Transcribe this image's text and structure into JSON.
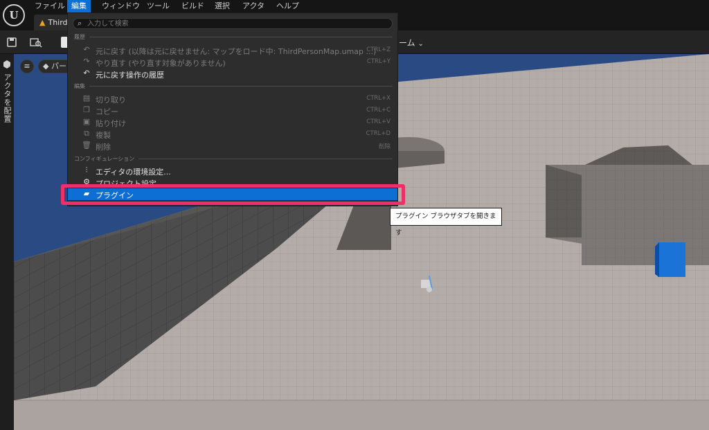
{
  "menubar": {
    "items": [
      "ファイル",
      "編集",
      "ウィンドウ",
      "ツール",
      "ビルド",
      "選択",
      "アクタ",
      "ヘルプ"
    ],
    "active": "編集"
  },
  "tab": {
    "title": "Third"
  },
  "toolbar": {
    "play_mode_label": "ーム"
  },
  "side": {
    "place_actors_label": "アクタを配置"
  },
  "viewport": {
    "view_label": "パー"
  },
  "edit_menu": {
    "search_placeholder": "入力して検索",
    "sections": {
      "history": "履歴",
      "edit": "編集",
      "configuration": "コンフィギュレーション"
    },
    "items": [
      {
        "label": "元に戻す (以降は元に戻せません: マップをロード中: ThirdPersonMap.umap ...)",
        "shortcut": "CTRL+Z",
        "icon": "undo-icon"
      },
      {
        "label": "やり直す (やり直す対象がありません)",
        "shortcut": "CTRL+Y",
        "icon": "redo-icon"
      },
      {
        "label": "元に戻す操作の履歴",
        "shortcut": "",
        "icon": "undo-history-icon"
      },
      {
        "label": "切り取り",
        "shortcut": "CTRL+X",
        "icon": "cut-icon"
      },
      {
        "label": "コピー",
        "shortcut": "CTRL+C",
        "icon": "copy-icon"
      },
      {
        "label": "貼り付け",
        "shortcut": "CTRL+V",
        "icon": "paste-icon"
      },
      {
        "label": "複製",
        "shortcut": "CTRL+D",
        "icon": "duplicate-icon"
      },
      {
        "label": "削除",
        "shortcut": "削除",
        "icon": "delete-icon"
      },
      {
        "label": "エディタの環境設定...",
        "shortcut": "",
        "icon": "editor-preferences-icon"
      },
      {
        "label": "プロジェクト設定",
        "shortcut": "",
        "icon": "project-settings-icon"
      },
      {
        "label": "プラグイン",
        "shortcut": "",
        "icon": "plugin-icon"
      }
    ]
  },
  "tooltip": {
    "text": "プラグイン ブラウザタブを開きます"
  },
  "colors": {
    "menu_active": "#0d6fd4",
    "highlight_frame": "#ef2f68",
    "sky": "#2a4a84",
    "floor": "#b3aca8",
    "cube": "#1a73d6"
  }
}
